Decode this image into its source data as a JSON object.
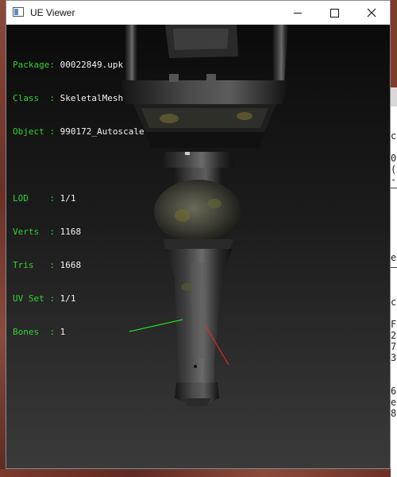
{
  "window": {
    "title": "UE Viewer",
    "controls": {
      "minimize": "minimize",
      "maximize": "maximize",
      "close": "close"
    }
  },
  "info": {
    "package_label": "Package:",
    "package_value": "00022849.upk",
    "class_label": "Class  :",
    "class_value": "SkeletalMesh",
    "object_label": "Object :",
    "object_value": "990172_Autoscale",
    "lod_label": "LOD    :",
    "lod_value": "1/1",
    "verts_label": "Verts  :",
    "verts_value": "1168",
    "tris_label": "Tris   :",
    "tris_value": "1668",
    "uvset_label": "UV Set :",
    "uvset_value": "1/1",
    "bones_label": "Bones  :",
    "bones_value": "1"
  },
  "colors": {
    "label_green": "#33d233",
    "value_white": "#f2f2f2",
    "axis_green": "#22ff22",
    "axis_red": "#ff2222"
  },
  "background_app_text": [
    "c",
    "0",
    "(",
    "-",
    "e",
    "-",
    "c",
    "F",
    "2",
    "7",
    "3",
    "6",
    "e",
    "8"
  ]
}
